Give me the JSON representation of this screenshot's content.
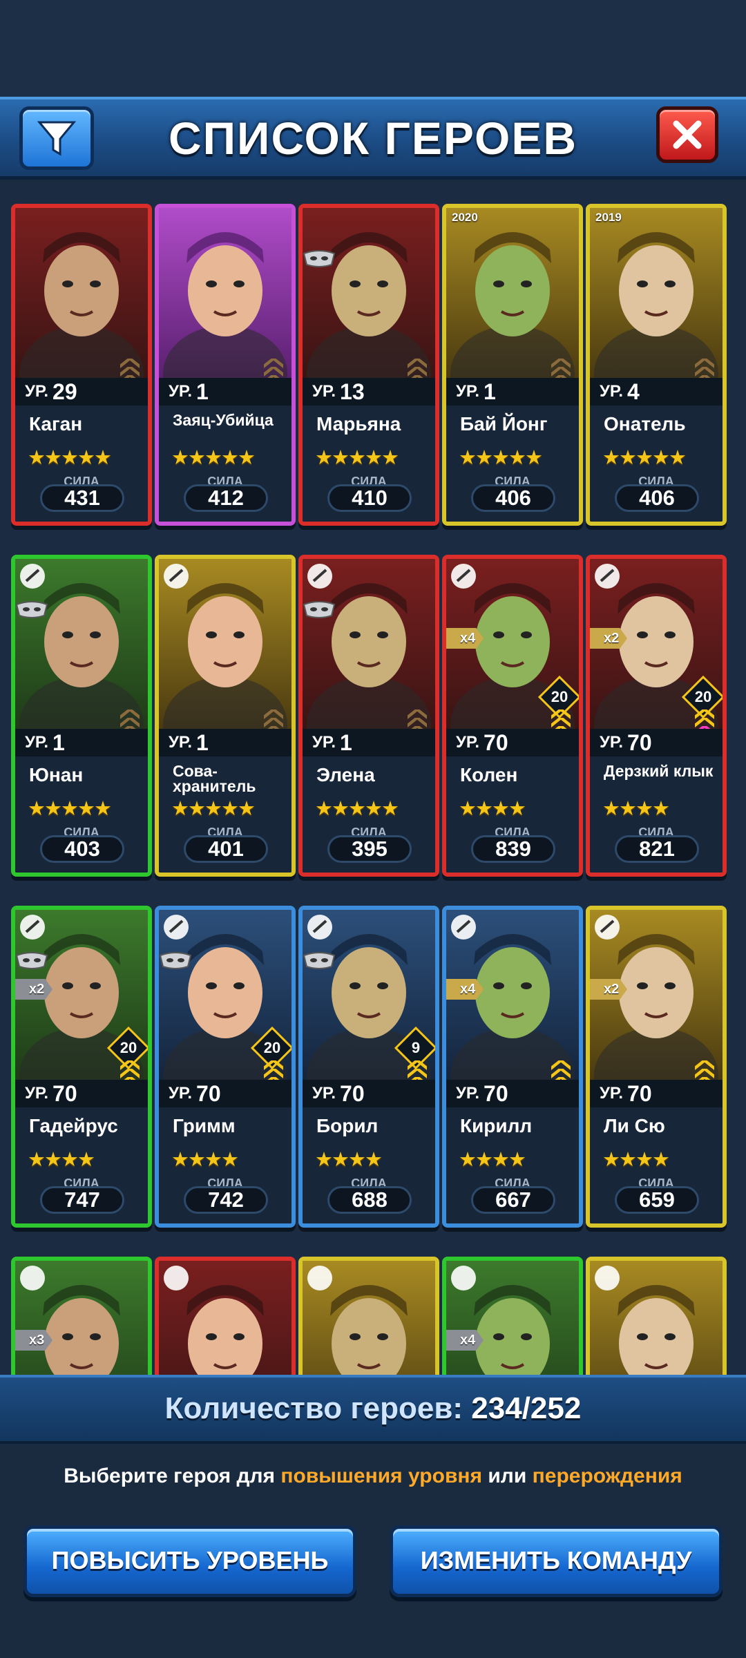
{
  "header": {
    "title": "СПИСОК ГЕРОЕВ"
  },
  "level_prefix": "УР.",
  "power_label": "СИЛА",
  "heroes": [
    {
      "name": "Каган",
      "level": "29",
      "stars": "★★★★★",
      "power": "431",
      "frame": "red"
    },
    {
      "name": "Заяц-Убийца",
      "level": "1",
      "stars": "★★★★★",
      "power": "412",
      "frame": "purple"
    },
    {
      "name": "Марьяна",
      "level": "13",
      "stars": "★★★★★",
      "power": "410",
      "frame": "red"
    },
    {
      "name": "Бай Йонг",
      "level": "1",
      "stars": "★★★★★",
      "power": "406",
      "frame": "yellow",
      "badge": "2020"
    },
    {
      "name": "Онатель",
      "level": "4",
      "stars": "★★★★★",
      "power": "406",
      "frame": "yellow",
      "badge": "2019"
    },
    {
      "name": "Юнан",
      "level": "1",
      "stars": "★★★★★",
      "power": "403",
      "frame": "green"
    },
    {
      "name": "Сова-хранитель",
      "level": "1",
      "stars": "★★★★★",
      "power": "401",
      "frame": "yellow"
    },
    {
      "name": "Элена",
      "level": "1",
      "stars": "★★★★★",
      "power": "395",
      "frame": "red"
    },
    {
      "name": "Колен",
      "level": "70",
      "stars": "★★★★",
      "power": "839",
      "frame": "red",
      "rank": "20",
      "multiplier": "x4"
    },
    {
      "name": "Дерзкий клык",
      "level": "70",
      "stars": "★★★★",
      "power": "821",
      "frame": "red",
      "rank": "20",
      "multiplier": "x2"
    },
    {
      "name": "Гадейрус",
      "level": "70",
      "stars": "★★★★",
      "power": "747",
      "frame": "green",
      "rank": "20",
      "multiplier": "x2"
    },
    {
      "name": "Гримм",
      "level": "70",
      "stars": "★★★★",
      "power": "742",
      "frame": "blue",
      "rank": "20"
    },
    {
      "name": "Борил",
      "level": "70",
      "stars": "★★★★",
      "power": "688",
      "frame": "blue",
      "rank": "9"
    },
    {
      "name": "Кирилл",
      "level": "70",
      "stars": "★★★★",
      "power": "667",
      "frame": "blue",
      "multiplier": "x4"
    },
    {
      "name": "Ли Сю",
      "level": "70",
      "stars": "★★★★",
      "power": "659",
      "frame": "yellow",
      "multiplier": "x2"
    }
  ],
  "partial_row": [
    {
      "frame": "green",
      "multiplier": "x3"
    },
    {
      "frame": "red"
    },
    {
      "frame": "yellow"
    },
    {
      "frame": "green",
      "multiplier": "x4"
    },
    {
      "frame": "yellow"
    }
  ],
  "footer": {
    "count_label": "Количество героев:",
    "count_value": "234/252",
    "hint_prefix": "Выберите героя для ",
    "hint_hl1": "повышения уровня",
    "hint_mid": " или ",
    "hint_hl2": "перерождения",
    "btn_level_up": "ПОВЫСИТЬ УРОВЕНЬ",
    "btn_change_team": "ИЗМЕНИТЬ КОМАНДУ"
  },
  "colors": {
    "red": "#db2e2a",
    "purple": "#c651d8",
    "yellow": "#d8c52a",
    "green": "#2ec72e",
    "blue": "#3c8ddb",
    "accent_orange": "#ffa928",
    "star": "#f5c518"
  }
}
